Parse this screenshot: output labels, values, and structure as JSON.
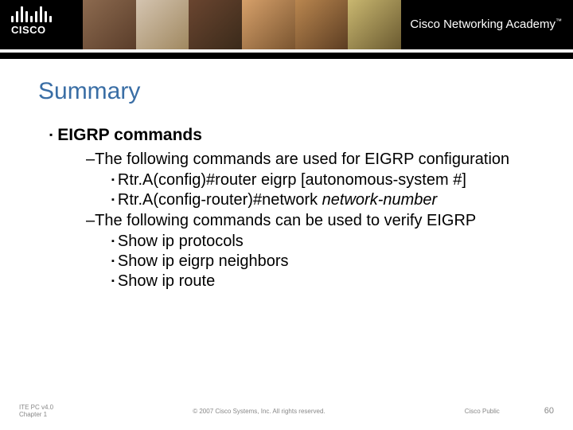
{
  "header": {
    "logo_text": "CISCO",
    "brand": "Cisco Networking Academy",
    "tm": "™"
  },
  "slide": {
    "title": "Summary",
    "section": "EIGRP commands",
    "intro1": "The following commands are used for EIGRP configuration",
    "cmd1": "Rtr.A(config)#router eigrp [autonomous-system #]",
    "cmd2_pre": "Rtr.A(config-router)#network ",
    "cmd2_it": "network-number",
    "intro2": "The following commands can be used to verify EIGRP",
    "v1": "Show ip protocols",
    "v2": "Show ip eigrp neighbors",
    "v3": "Show ip route"
  },
  "footer": {
    "left_line1": "ITE PC v4.0",
    "left_line2": "Chapter 1",
    "center": "© 2007 Cisco Systems, Inc. All rights reserved.",
    "right": "Cisco Public",
    "page": "60"
  }
}
